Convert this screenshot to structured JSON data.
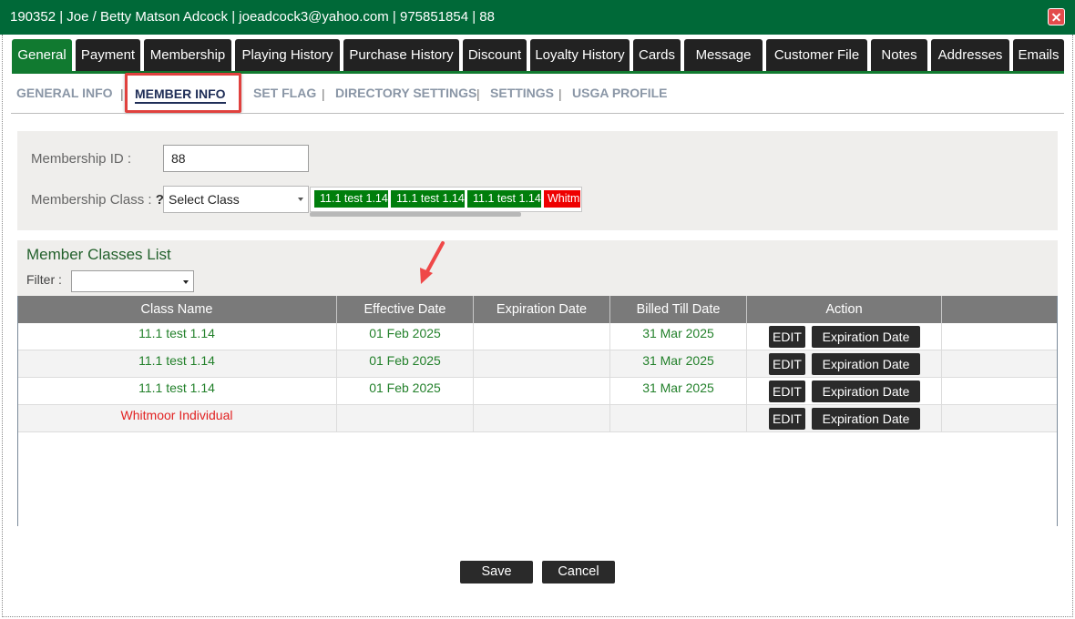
{
  "window": {
    "title": "190352 |  Joe / Betty Matson Adcock | joeadcock3@yahoo.com | 975851854 | 88",
    "close_icon": "close-icon"
  },
  "tabs": [
    {
      "label": "General",
      "active": true
    },
    {
      "label": "Payment"
    },
    {
      "label": "Membership"
    },
    {
      "label": "Playing History"
    },
    {
      "label": "Purchase History"
    },
    {
      "label": "Discount"
    },
    {
      "label": "Loyalty History"
    },
    {
      "label": "Cards"
    },
    {
      "label": "Message"
    },
    {
      "label": "Customer File"
    },
    {
      "label": "Notes"
    },
    {
      "label": "Addresses"
    },
    {
      "label": "Emails"
    }
  ],
  "subnav": {
    "items": [
      "GENERAL INFO",
      "MEMBER INFO",
      "SET FLAG",
      "DIRECTORY SETTINGS",
      "SETTINGS",
      "USGA PROFILE"
    ],
    "active": "MEMBER INFO",
    "separator": "|"
  },
  "member_info": {
    "membership_id_label": "Membership ID :",
    "membership_id_value": "88",
    "membership_class_label": "Membership Class : ",
    "membership_class_help": "?",
    "select_class_value": "Select Class",
    "class_chips": [
      "11.1 test 1.14",
      "11.1 test 1.14",
      "11.1 test 1.14",
      "Whitm"
    ]
  },
  "classes_list": {
    "title": "Member Classes List",
    "filter_label": "Filter :",
    "filter_value": "",
    "columns": [
      "Class Name",
      "Effective Date",
      "Expiration Date",
      "Billed Till Date",
      "Action"
    ],
    "rows": [
      {
        "class_name": "11.1 test 1.14",
        "effective_date": "01 Feb 2025",
        "expiration_date": "",
        "billed_till": "31 Mar 2025",
        "status": "green"
      },
      {
        "class_name": "11.1 test 1.14",
        "effective_date": "01 Feb 2025",
        "expiration_date": "",
        "billed_till": "31 Mar 2025",
        "status": "green"
      },
      {
        "class_name": "11.1 test 1.14",
        "effective_date": "01 Feb 2025",
        "expiration_date": "",
        "billed_till": "31 Mar 2025",
        "status": "green"
      },
      {
        "class_name": "Whitmoor Individual",
        "effective_date": "",
        "expiration_date": "",
        "billed_till": "",
        "status": "red"
      }
    ],
    "edit_label": "EDIT",
    "expiration_label": "Expiration Date"
  },
  "footer": {
    "save_label": "Save",
    "cancel_label": "Cancel"
  },
  "colors": {
    "title_bar": "#006938",
    "active_tab": "#117a30",
    "tab": "#222222",
    "highlight": "#e0413e",
    "green_text": "#22802a",
    "red_text": "#e22222"
  }
}
